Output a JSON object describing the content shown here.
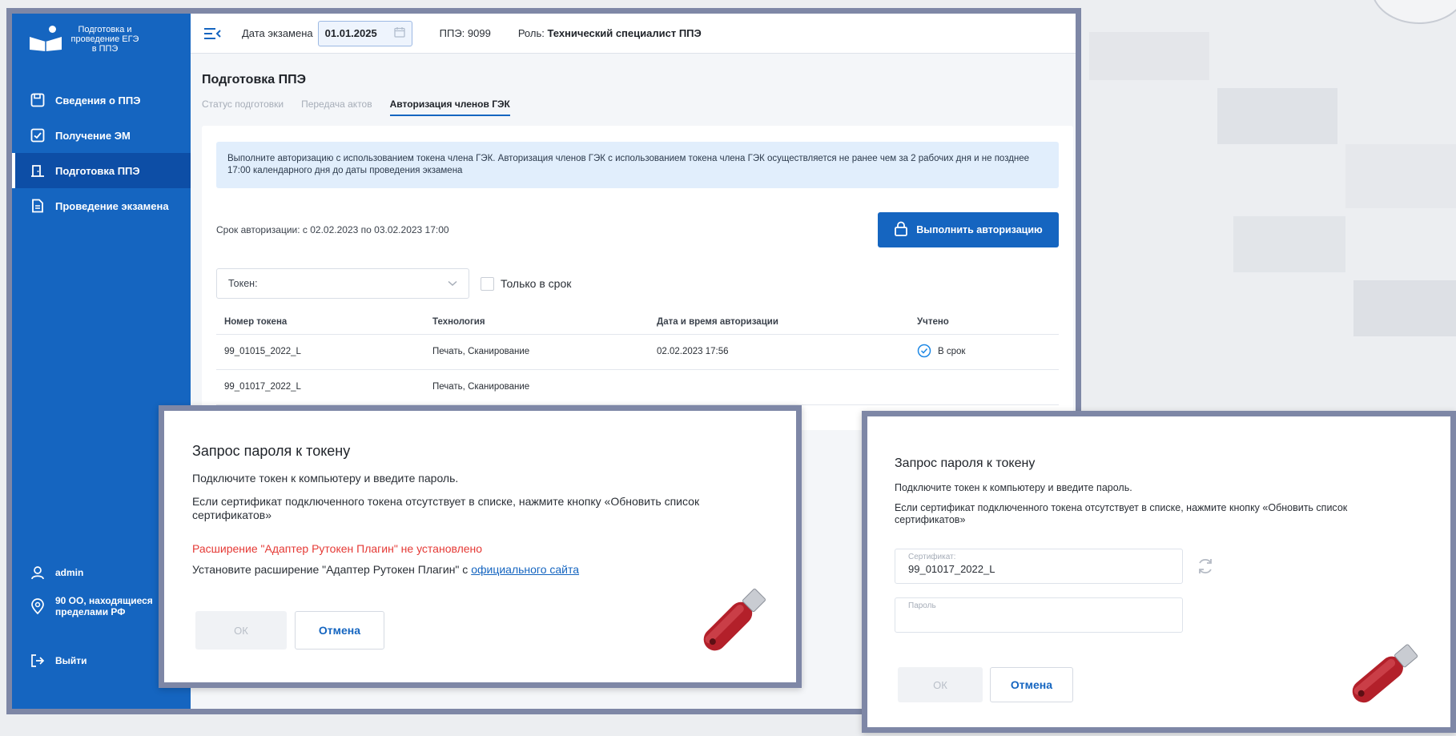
{
  "sidebar": {
    "logo_text": "Подготовка и проведение ЕГЭ в ППЭ",
    "items": [
      {
        "label": "Сведения о ППЭ",
        "icon": "save-icon"
      },
      {
        "label": "Получение ЭМ",
        "icon": "check-document-icon"
      },
      {
        "label": "Подготовка ППЭ",
        "icon": "door-icon",
        "active": true
      },
      {
        "label": "Проведение экзамена",
        "icon": "document-icon"
      }
    ],
    "user": "admin",
    "location": "90 ОО, находящиеся пределами РФ",
    "logout": "Выйти"
  },
  "topbar": {
    "exam_date_label": "Дата экзамена",
    "exam_date_value": "01.01.2025",
    "ppe": "ППЭ: 9099",
    "role_label": "Роль:",
    "role_value": "Технический специалист ППЭ"
  },
  "page": {
    "title": "Подготовка ППЭ",
    "tabs": [
      "Статус подготовки",
      "Передача актов",
      "Авторизация членов ГЭК"
    ],
    "active_tab": 2,
    "info": "Выполните авторизацию с использованием токена члена ГЭК. Авторизация членов ГЭК с использованием токена члена ГЭК осуществляется не ранее чем за 2 рабочих дня и не позднее 17:00 календарного дня до даты проведения экзамена",
    "auth_term": "Срок авторизации: с 02.02.2023 по 03.02.2023 17:00",
    "auth_button": "Выполнить авторизацию",
    "token_select": "Токен:",
    "only_in_time": "Только в срок",
    "table": {
      "headers": [
        "Номер токена",
        "Технология",
        "Дата и время авторизации",
        "Учтено"
      ],
      "rows": [
        {
          "token": "99_01015_2022_L",
          "tech": "Печать, Сканирование",
          "datetime": "02.02.2023 17:56",
          "status": "В срок"
        },
        {
          "token": "99_01017_2022_L",
          "tech": "Печать, Сканирование",
          "datetime": "",
          "status": ""
        }
      ]
    }
  },
  "dialog1": {
    "title": "Запрос пароля к токену",
    "p1": "Подключите токен к компьютеру и введите пароль.",
    "p2": "Если сертификат подключенного токена отсутствует в списке, нажмите кнопку «Обновить список сертификатов»",
    "error": "Расширение \"Адаптер Рутокен Плагин\" не установлено",
    "install_text": "Установите расширение \"Адаптер Рутокен Плагин\" с ",
    "install_link": "официального сайта",
    "ok": "ОК",
    "cancel": "Отмена"
  },
  "dialog2": {
    "title": "Запрос пароля к токену",
    "p1": "Подключите токен к компьютеру и введите пароль.",
    "p2": "Если сертификат подключенного токена отсутствует в списке, нажмите кнопку «Обновить список сертификатов»",
    "cert_label": "Сертификат:",
    "cert_value": "99_01017_2022_L",
    "password_label": "Пароль",
    "ok": "ОК",
    "cancel": "Отмена"
  },
  "colors": {
    "sidebar": "#1565c0",
    "accent": "#1565c0",
    "error": "#e53935",
    "status_ok": "#1e88e5",
    "token_body": "#b3202a"
  }
}
